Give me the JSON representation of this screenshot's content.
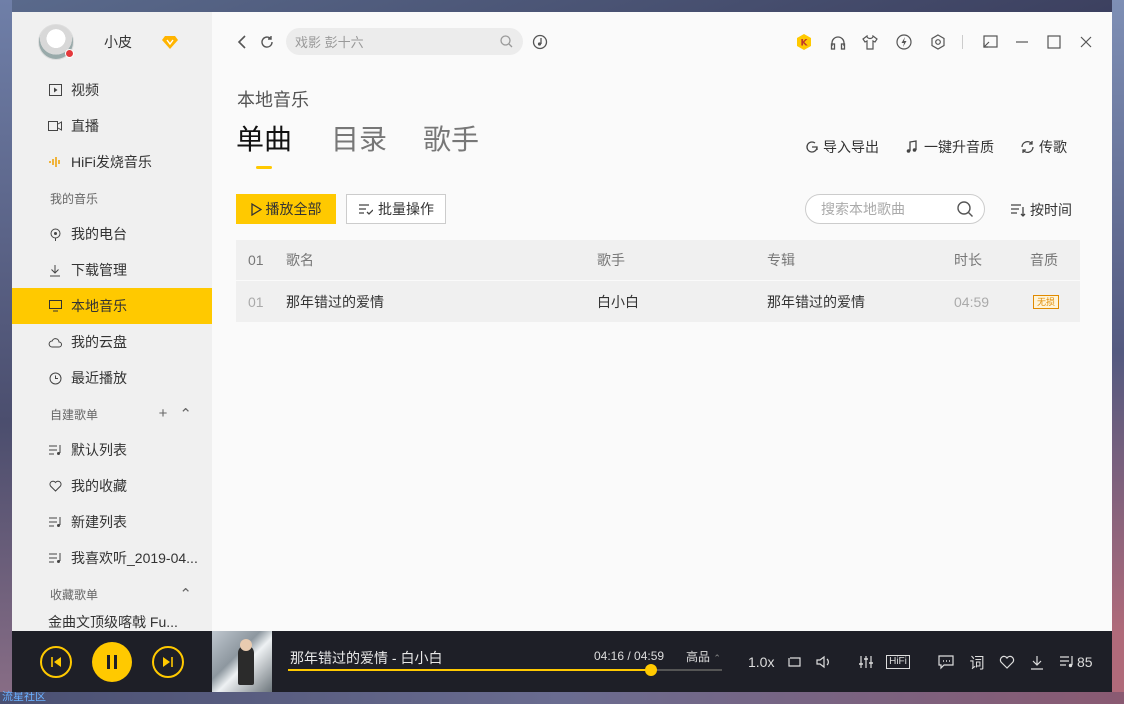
{
  "sidebar": {
    "username": "小皮",
    "nav_top": [
      "视频",
      "直播",
      "HiFi发烧音乐"
    ],
    "section_my_music": "我的音乐",
    "nav_my": [
      "我的电台",
      "下载管理",
      "本地音乐",
      "我的云盘",
      "最近播放"
    ],
    "section_custom": "自建歌单",
    "nav_custom": [
      "默认列表",
      "我的收藏",
      "新建列表",
      "我喜欢听_2019-04..."
    ],
    "section_fav": "收藏歌单",
    "nav_fav": [
      "金曲文顶级喀戟 Fu..."
    ]
  },
  "topbar": {
    "search_placeholder": "戏影 彭十六"
  },
  "main": {
    "page_title": "本地音乐",
    "tabs": [
      "单曲",
      "目录",
      "歌手"
    ],
    "actions": [
      "导入导出",
      "一键升音质",
      "传歌"
    ],
    "play_all": "播放全部",
    "batch": "批量操作",
    "local_search_placeholder": "搜索本地歌曲",
    "sort": "按时间"
  },
  "table": {
    "headers": {
      "index": "01",
      "title": "歌名",
      "artist": "歌手",
      "album": "专辑",
      "duration": "时长",
      "quality": "音质"
    },
    "rows": [
      {
        "index": "01",
        "title": "那年错过的爱情",
        "artist": "白小白",
        "album": "那年错过的爱情",
        "duration": "04:59",
        "quality": "无损"
      }
    ]
  },
  "player": {
    "now_playing": "那年错过的爱情 - 白小白",
    "time": "04:16 / 04:59",
    "quality": "高品",
    "progress": 0.836,
    "speed": "1.0x",
    "hifi": "HiFi",
    "lyric": "词",
    "playlist_count": "85"
  },
  "desktop": {
    "label": "流星社区"
  },
  "colors": {
    "accent": "#ffc900",
    "player_bg": "#1e1f27",
    "sidebar_bg": "#f0f0f0"
  }
}
